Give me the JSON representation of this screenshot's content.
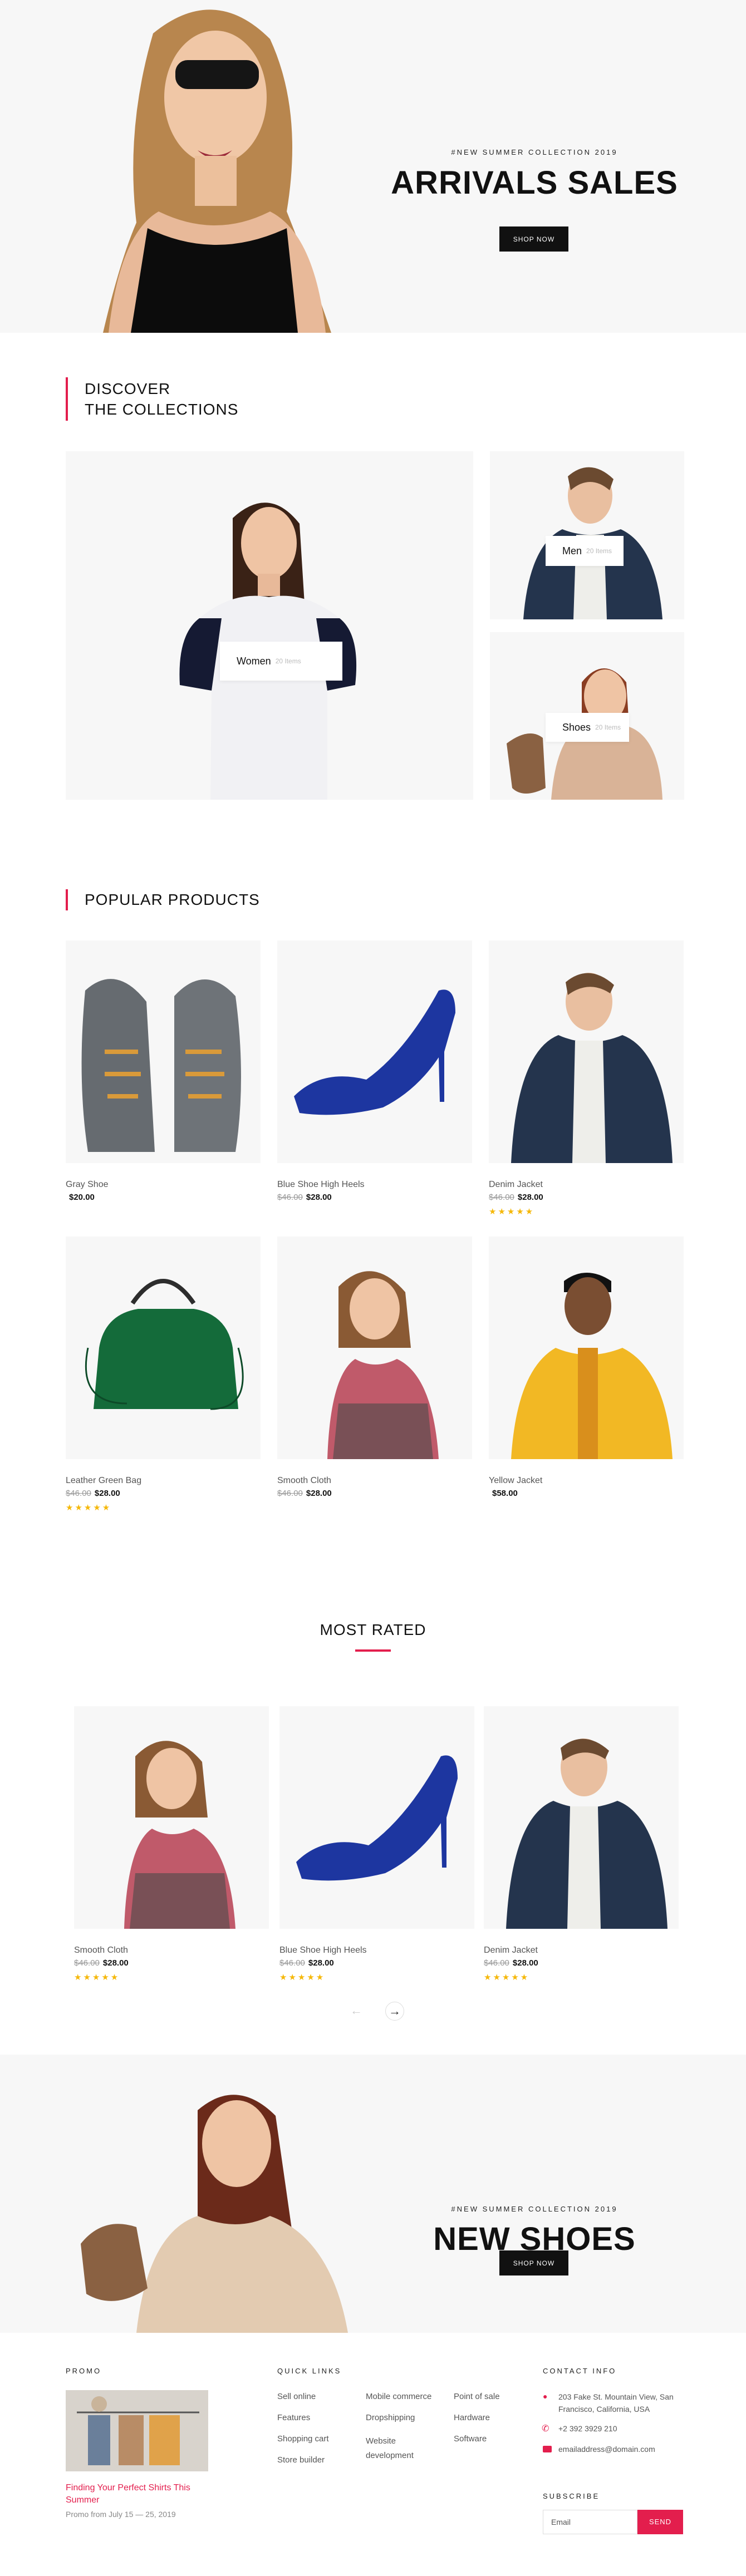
{
  "hero": {
    "eyebrow": "#NEW SUMMER COLLECTION 2019",
    "title": "ARRIVALS SALES",
    "button": "SHOP NOW"
  },
  "collections": {
    "title_line1": "DISCOVER",
    "title_line2": "THE COLLECTIONS",
    "items": [
      {
        "label": "Women",
        "count": "20 Items"
      },
      {
        "label": "Men",
        "count": "20 Items"
      },
      {
        "label": "Shoes",
        "count": "20 Items"
      }
    ]
  },
  "popular": {
    "title": "POPULAR PRODUCTS",
    "products": [
      {
        "name": "Gray Shoe",
        "old": "",
        "price": "$20.00",
        "stars": ""
      },
      {
        "name": "Blue Shoe High Heels",
        "old": "$46.00",
        "price": "$28.00",
        "stars": ""
      },
      {
        "name": "Denim Jacket",
        "old": "$46.00",
        "price": "$28.00",
        "stars": "★★★★★"
      },
      {
        "name": "Leather Green Bag",
        "old": "$46.00",
        "price": "$28.00",
        "stars": "★★★★★"
      },
      {
        "name": "Smooth Cloth",
        "old": "$46.00",
        "price": "$28.00",
        "stars": ""
      },
      {
        "name": "Yellow Jacket",
        "old": "",
        "price": "$58.00",
        "stars": ""
      }
    ]
  },
  "most_rated": {
    "title": "MOST RATED",
    "products": [
      {
        "name": "Smooth Cloth",
        "old": "$46.00",
        "price": "$28.00",
        "stars": "★★★★★"
      },
      {
        "name": "Blue Shoe High Heels",
        "old": "$46.00",
        "price": "$28.00",
        "stars": "★★★★★"
      },
      {
        "name": "Denim Jacket",
        "old": "$46.00",
        "price": "$28.00",
        "stars": "★★★★★"
      }
    ],
    "prev": "←",
    "next": "→"
  },
  "promo_banner": {
    "eyebrow": "#NEW SUMMER COLLECTION 2019",
    "title": "NEW SHOES",
    "button": "SHOP NOW"
  },
  "footer": {
    "promo": {
      "heading": "PROMO",
      "title": "Finding Your Perfect Shirts This Summer",
      "dates": "Promo from July 15 — 25, 2019"
    },
    "quick_links": {
      "heading": "QUICK LINKS",
      "col1": [
        "Sell online",
        "Features",
        "Shopping cart",
        "Store builder"
      ],
      "col2": [
        "Mobile commerce",
        "Dropshipping",
        "Website development"
      ],
      "col3": [
        "Point of sale",
        "Hardware",
        "Software"
      ]
    },
    "contact": {
      "heading": "CONTACT INFO",
      "address": "203 Fake St. Mountain View, San Francisco, California, USA",
      "phone": "+2 392 3929 210",
      "email": "emailaddress@domain.com"
    },
    "subscribe": {
      "heading": "SUBSCRIBE",
      "placeholder": "Email",
      "button": "SEND"
    }
  },
  "colors": {
    "accent": "#e31e4d",
    "star": "#f5b80a",
    "dark": "#111111",
    "panel": "#f7f7f7"
  }
}
